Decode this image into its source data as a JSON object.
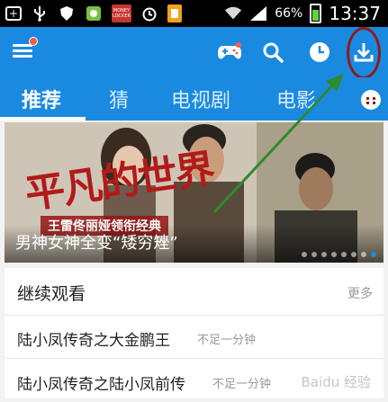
{
  "status_bar": {
    "battery_percent": "66%",
    "time": "13:37",
    "icons": [
      "add-box-icon",
      "usb-icon",
      "shield-icon",
      "app-icon",
      "money-locker-icon",
      "alarm-icon",
      "document-icon",
      "wifi-icon",
      "signal-icon",
      "battery-icon"
    ],
    "money_locker_label": "MONEY LOCKER"
  },
  "app_bar": {
    "icons": [
      "menu-icon",
      "game-controller-icon",
      "search-icon",
      "history-clock-icon",
      "download-icon"
    ],
    "accent_color": "#1a8ae0",
    "highlight_color": "#8e1b1b"
  },
  "tabs": [
    {
      "label": "推荐",
      "active": true
    },
    {
      "label": "猜"
    },
    {
      "label": "电视剧"
    },
    {
      "label": "电影"
    }
  ],
  "banner": {
    "caption": "男神女神全变“矮穷矬”",
    "poster_title": "平凡的世界",
    "poster_subtitle": "王雷佟丽娅领衔经典",
    "page_count": 8,
    "active_page": 8
  },
  "continue_watching": {
    "title": "继续观看",
    "more_label": "更多",
    "items": [
      {
        "name": "陆小凤传奇之大金鹏王",
        "progress": "不足一分钟"
      },
      {
        "name": "陆小凤传奇之陆小凤前传",
        "progress": "不足一分钟"
      }
    ]
  },
  "watermark": "Baidu 经验"
}
